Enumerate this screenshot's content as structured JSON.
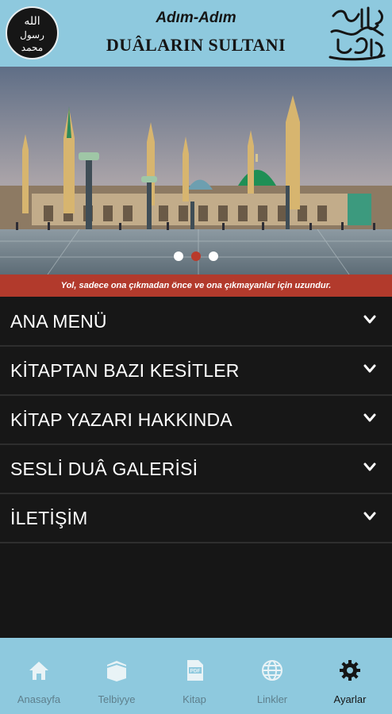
{
  "header": {
    "logo_icon": "seal-icon",
    "logo_text": [
      "الله",
      "رسول",
      "محمد"
    ],
    "subtitle": "Adım-Adım",
    "title": "DUÂLARIN SULTANI",
    "calligraphy_icon": "salawat-calligraphy-icon"
  },
  "carousel": {
    "slides_count": 3,
    "active_index": 1
  },
  "banner": {
    "text": "Yol, sadece ona çıkmadan önce ve ona çıkmayanlar için uzundur."
  },
  "menu": {
    "items": [
      {
        "label": "ANA MENÜ",
        "icon": "chevron-down-icon"
      },
      {
        "label": "KİTAPTAN BAZI KESİTLER",
        "icon": "chevron-down-icon"
      },
      {
        "label": "KİTAP YAZARI HAKKINDA",
        "icon": "chevron-down-icon"
      },
      {
        "label": "SESLİ DUÂ GALERİSİ",
        "icon": "chevron-down-icon"
      },
      {
        "label": "İLETİŞİM",
        "icon": "chevron-down-icon"
      }
    ]
  },
  "bottom_nav": {
    "tabs": [
      {
        "label": "Anasayfa",
        "icon": "home-icon",
        "active": false
      },
      {
        "label": "Telbiyye",
        "icon": "kaaba-icon",
        "active": false
      },
      {
        "label": "Kitap",
        "icon": "pdf-icon",
        "active": false
      },
      {
        "label": "Linkler",
        "icon": "globe-icon",
        "active": false
      },
      {
        "label": "Ayarlar",
        "icon": "gear-icon",
        "active": true
      }
    ]
  },
  "colors": {
    "header_bg": "#8ec9de",
    "banner_bg": "#b23a2c",
    "menu_bg": "#171717",
    "active_dot": "#b93a2b"
  }
}
